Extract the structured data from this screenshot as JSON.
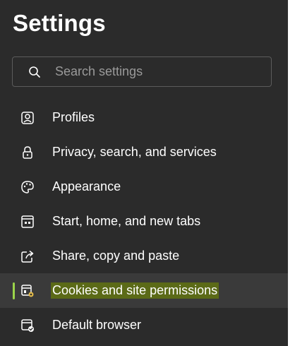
{
  "header": {
    "title": "Settings"
  },
  "search": {
    "placeholder": "Search settings",
    "icon": "search-icon"
  },
  "nav": {
    "items": [
      {
        "label": "Profiles",
        "icon": "profile-icon",
        "active": false
      },
      {
        "label": "Privacy, search, and services",
        "icon": "lock-icon",
        "active": false
      },
      {
        "label": "Appearance",
        "icon": "palette-icon",
        "active": false
      },
      {
        "label": "Start, home, and new tabs",
        "icon": "start-page-icon",
        "active": false
      },
      {
        "label": "Share, copy and paste",
        "icon": "share-icon",
        "active": false
      },
      {
        "label": "Cookies and site permissions",
        "icon": "cookies-permissions-icon",
        "active": true
      },
      {
        "label": "Default browser",
        "icon": "default-browser-icon",
        "active": false
      }
    ]
  },
  "colors": {
    "panel_bg": "#2b2b2b",
    "active_bg": "#3a3a3a",
    "active_indicator": "#9bd44a",
    "highlight": "#5b6a17",
    "text": "#ffffff",
    "placeholder": "#9a9a9a"
  }
}
